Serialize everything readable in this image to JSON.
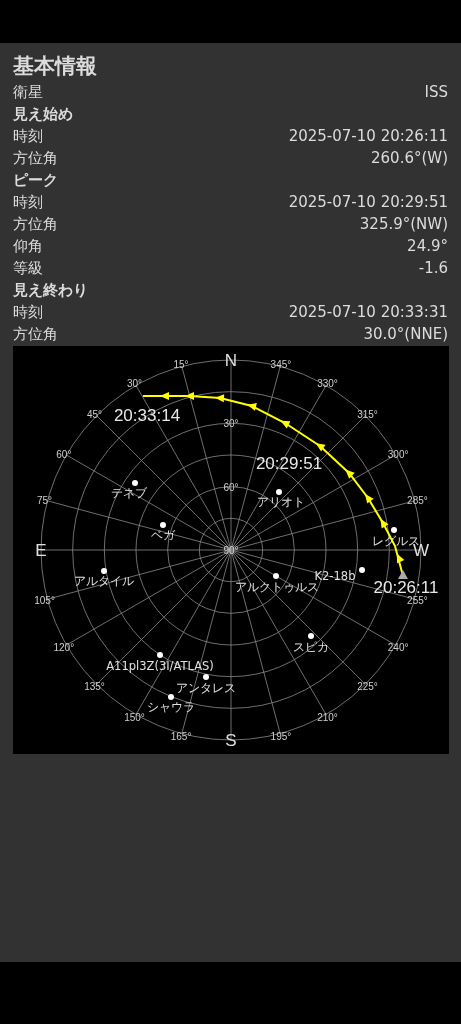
{
  "title": "基本情報",
  "rows": [
    {
      "kind": "row",
      "label": "衛星",
      "value": "ISS"
    },
    {
      "kind": "heading",
      "label": "見え始め"
    },
    {
      "kind": "row",
      "label": "時刻",
      "value": "2025-07-10 20:26:11"
    },
    {
      "kind": "row",
      "label": "方位角",
      "value": "260.6°(W)"
    },
    {
      "kind": "heading",
      "label": "ピーク"
    },
    {
      "kind": "row",
      "label": "時刻",
      "value": "2025-07-10 20:29:51"
    },
    {
      "kind": "row",
      "label": "方位角",
      "value": "325.9°(NW)"
    },
    {
      "kind": "row",
      "label": "仰角",
      "value": "24.9°"
    },
    {
      "kind": "row",
      "label": "等級",
      "value": "-1.6"
    },
    {
      "kind": "heading",
      "label": "見え終わり"
    },
    {
      "kind": "row",
      "label": "時刻",
      "value": "2025-07-10 20:33:31"
    },
    {
      "kind": "row",
      "label": "方位角",
      "value": "30.0°(NNE)"
    }
  ],
  "sky_chart": {
    "directions": [
      "N",
      "E",
      "S",
      "W"
    ],
    "altitude_labels": [
      "30°",
      "60°",
      "90°"
    ],
    "azimuth_labels": [
      "15°",
      "30°",
      "45°",
      "60°",
      "75°",
      "105°",
      "120°",
      "135°",
      "150°",
      "165°",
      "195°",
      "210°",
      "225°",
      "240°",
      "255°",
      "285°",
      "300°",
      "315°",
      "330°",
      "345°"
    ],
    "objects": [
      {
        "name": "テネブ"
      },
      {
        "name": "ベガ"
      },
      {
        "name": "アリオト"
      },
      {
        "name": "レグルス"
      },
      {
        "name": "アルタイル"
      },
      {
        "name": "アルクトゥルス"
      },
      {
        "name": "K2-18b"
      },
      {
        "name": "スピカ"
      },
      {
        "name": "A11pl3Z(3I/ATLAS)"
      },
      {
        "name": "アンタレス"
      },
      {
        "name": "シャウラ"
      }
    ],
    "pass_times": [
      "20:33:14",
      "20:29:51",
      "20:26:11"
    ]
  }
}
